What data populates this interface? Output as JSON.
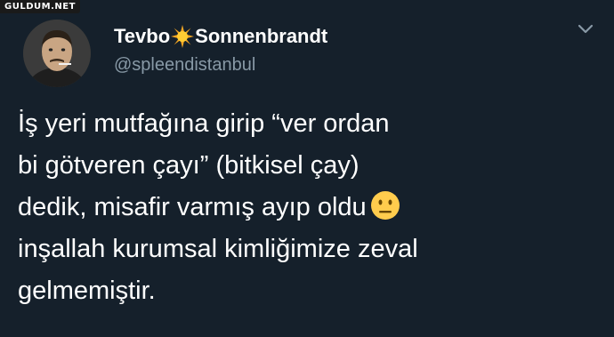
{
  "watermark": {
    "text": "GULDUM.NET"
  },
  "user": {
    "name_part1": "Tevbo",
    "name_part2": "Sonnenbrandt",
    "name_icon": "sun-icon",
    "handle": "@spleendistanbul"
  },
  "tweet": {
    "lines": [
      "İş yeri mutfağına girip “ver ordan",
      "bi götveren çayı” (bitkisel çay)",
      "dedik, misafir varmış ayıp oldu",
      "inşallah kurumsal kimliğimize zeval",
      "gelmemiştir."
    ],
    "emoji": "neutral-face-emoji"
  },
  "colors": {
    "background": "#15202b",
    "text": "#ffffff",
    "handle": "#8899a6",
    "emoji": "#ffcc4d"
  }
}
